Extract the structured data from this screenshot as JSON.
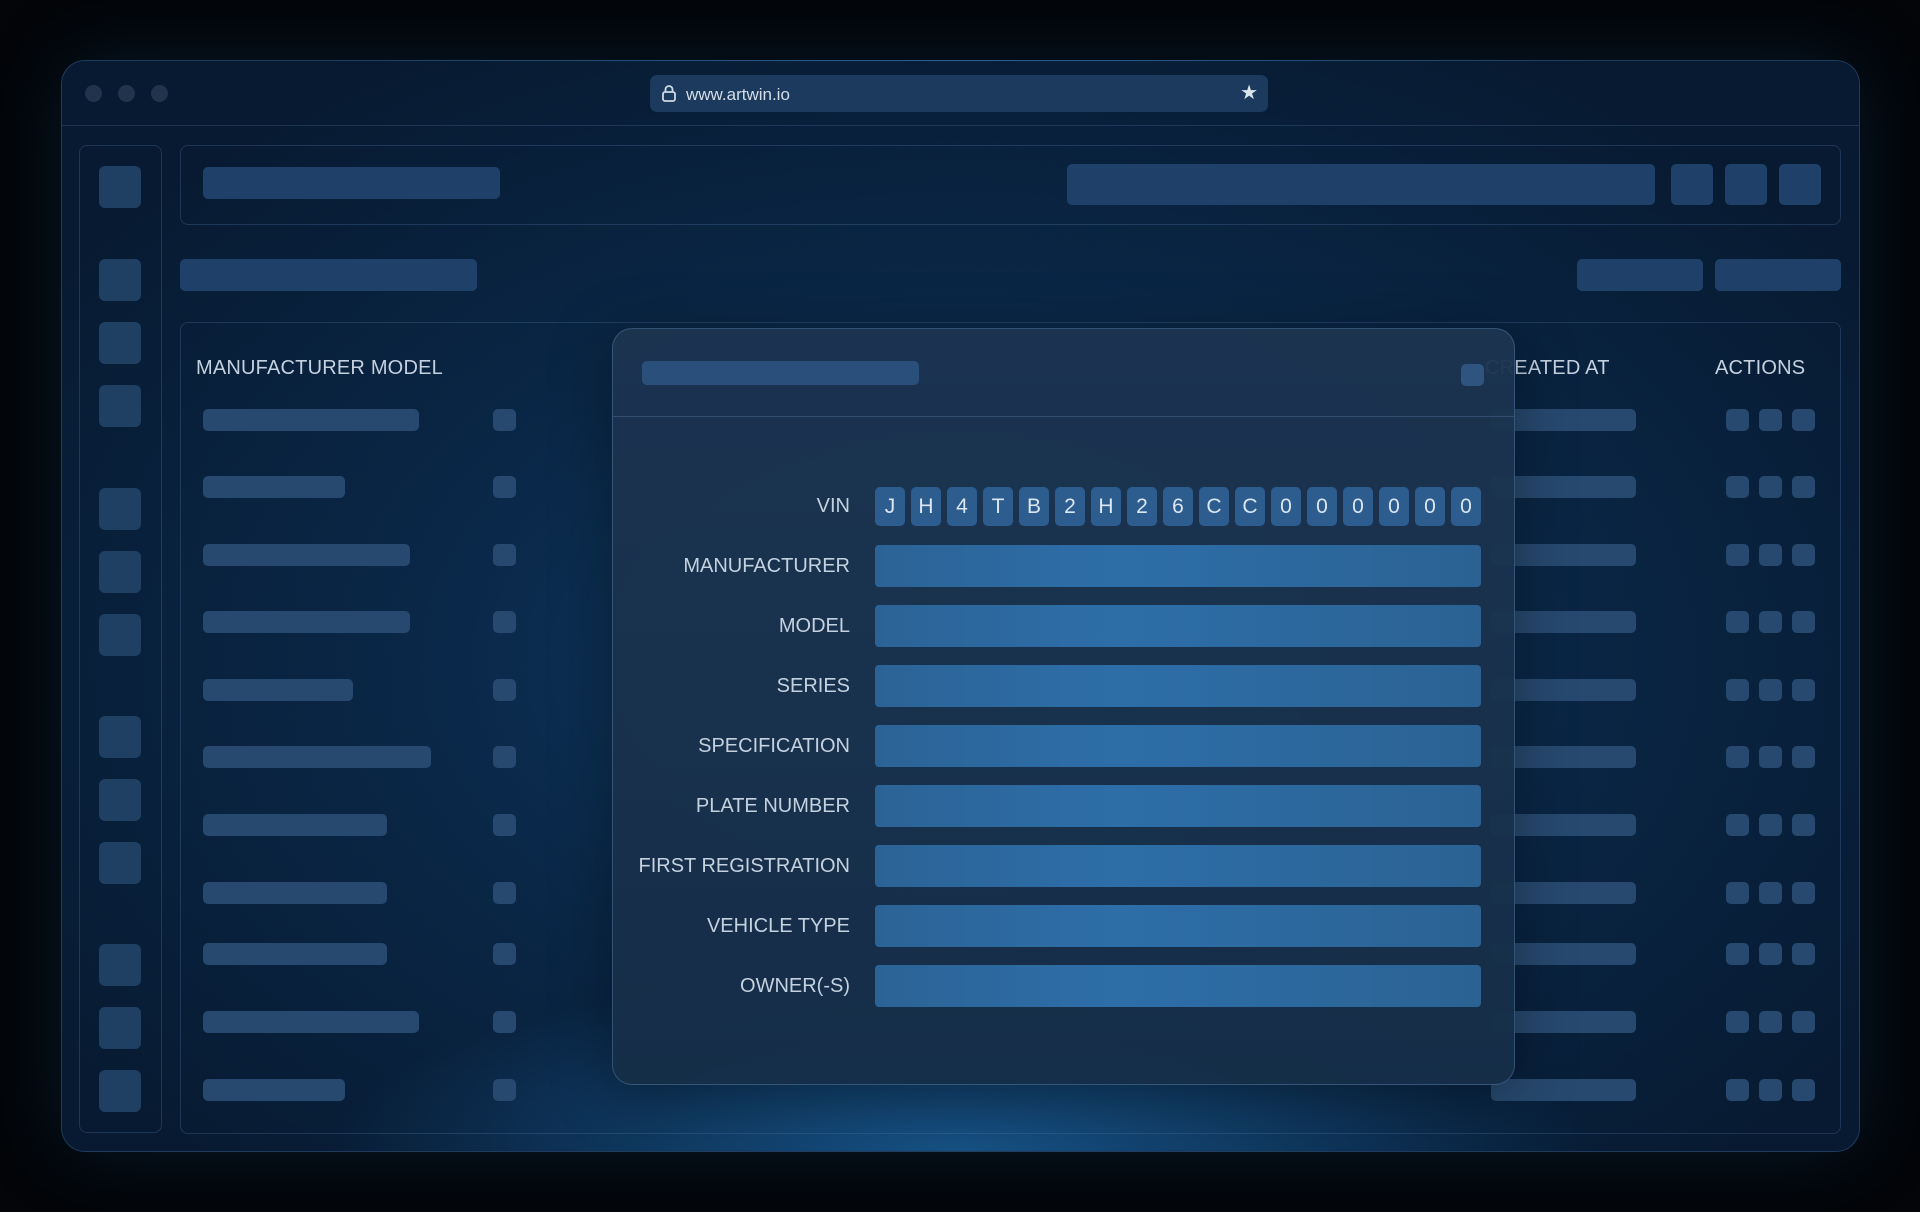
{
  "browser": {
    "url": "www.artwin.io",
    "lock_icon": "lock-icon",
    "bookmark_icon": "star-icon"
  },
  "table": {
    "columns": [
      "MANUFACTURER MODEL",
      "CREATED AT",
      "ACTIONS"
    ]
  },
  "modal": {
    "vin_label": "VIN",
    "vin": [
      "J",
      "H",
      "4",
      "T",
      "B",
      "2",
      "H",
      "2",
      "6",
      "C",
      "C",
      "0",
      "0",
      "0",
      "0",
      "0",
      "0"
    ],
    "fields": [
      {
        "label": "MANUFACTURER",
        "value": ""
      },
      {
        "label": "MODEL",
        "value": ""
      },
      {
        "label": "SERIES",
        "value": ""
      },
      {
        "label": "SPECIFICATION",
        "value": ""
      },
      {
        "label": "PLATE NUMBER",
        "value": ""
      },
      {
        "label": "FIRST REGISTRATION",
        "value": ""
      },
      {
        "label": "VEHICLE TYPE",
        "value": ""
      },
      {
        "label": "OWNER(-S)",
        "value": ""
      }
    ]
  },
  "colors": {
    "background": "#030508",
    "window": "#0a2747",
    "placeholder": "#27496f",
    "input": "#2d6ea8"
  }
}
